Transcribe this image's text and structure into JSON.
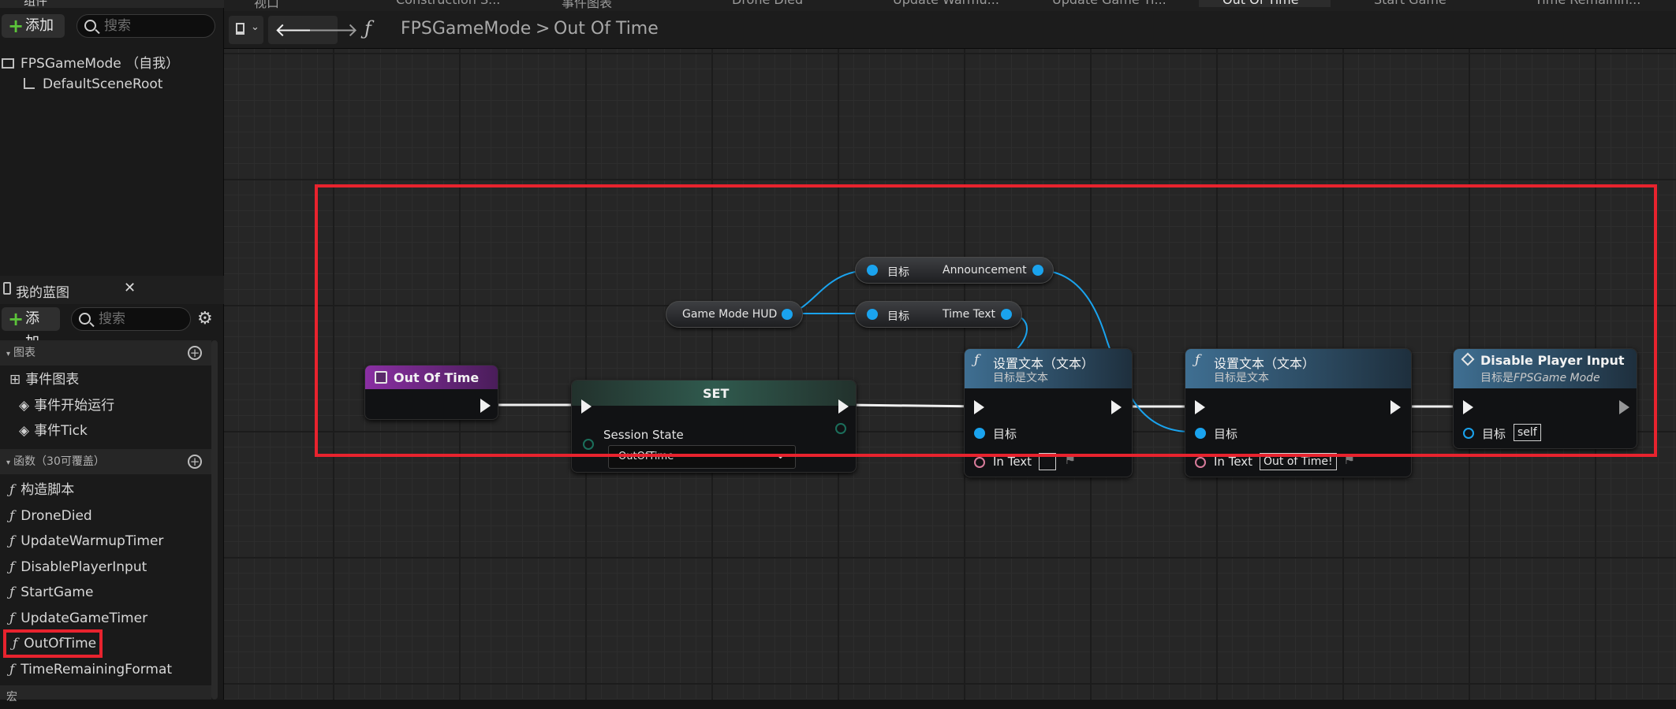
{
  "tabs": [
    "视口",
    "Construction S...",
    "事件图表",
    "Drone Died",
    "Update Warmu...",
    "Update Game Ti...",
    "Out Of Time",
    "Start Game",
    "Time Remainin..."
  ],
  "components_panel": {
    "title": "组件",
    "add_label": "添加",
    "search_placeholder": "搜索",
    "tree": [
      "FPSGameMode （自我）",
      "DefaultSceneRoot"
    ]
  },
  "blueprint_panel": {
    "title": "我的蓝图",
    "add_label": "添加",
    "search_placeholder": "搜索",
    "graphs_section": "图表",
    "graph_items": [
      "事件图表",
      "事件开始运行",
      "事件Tick"
    ],
    "functions_section": "函数（30可覆盖）",
    "function_items": [
      "构造脚本",
      "DroneDied",
      "UpdateWarmupTimer",
      "DisablePlayerInput",
      "StartGame",
      "UpdateGameTimer",
      "OutOfTime",
      "TimeRemainingFormat"
    ],
    "selected_function": "OutOfTime",
    "macros_section": "宏"
  },
  "breadcrumb": {
    "root": "FPSGameMode",
    "separator": ">",
    "current": "Out Of Time"
  },
  "nodes": {
    "entry": {
      "title": "Out Of Time"
    },
    "set": {
      "title": "SET",
      "var_label": "Session State",
      "dropdown_value": "OutOfTime"
    },
    "hud": {
      "label": "Game Mode HUD"
    },
    "announcement": {
      "in_label": "目标",
      "out_label": "Announcement"
    },
    "timetext": {
      "in_label": "目标",
      "out_label": "Time Text"
    },
    "settext1": {
      "title": "设置文本（文本）",
      "subtitle": "目标是文本",
      "target_label": "目标",
      "intext_label": "In Text",
      "intext_value": ""
    },
    "settext2": {
      "title": "设置文本（文本）",
      "subtitle": "目标是文本",
      "target_label": "目标",
      "intext_label": "In Text",
      "intext_value": "Out of Time!"
    },
    "disable": {
      "title": "Disable Player Input",
      "subtitle_prefix": "目标是",
      "subtitle_class": "FPSGame Mode",
      "target_label": "目标",
      "target_value": "self"
    }
  },
  "colors": {
    "highlight": "#e8232e",
    "exec_wire": "#f0f0f0",
    "object_wire": "#1aa3ee",
    "entry_header": "#7b2a8c",
    "set_header": "#2b4d43",
    "settext_header": "#2d4a62",
    "accent_add": "#5cc43a"
  }
}
